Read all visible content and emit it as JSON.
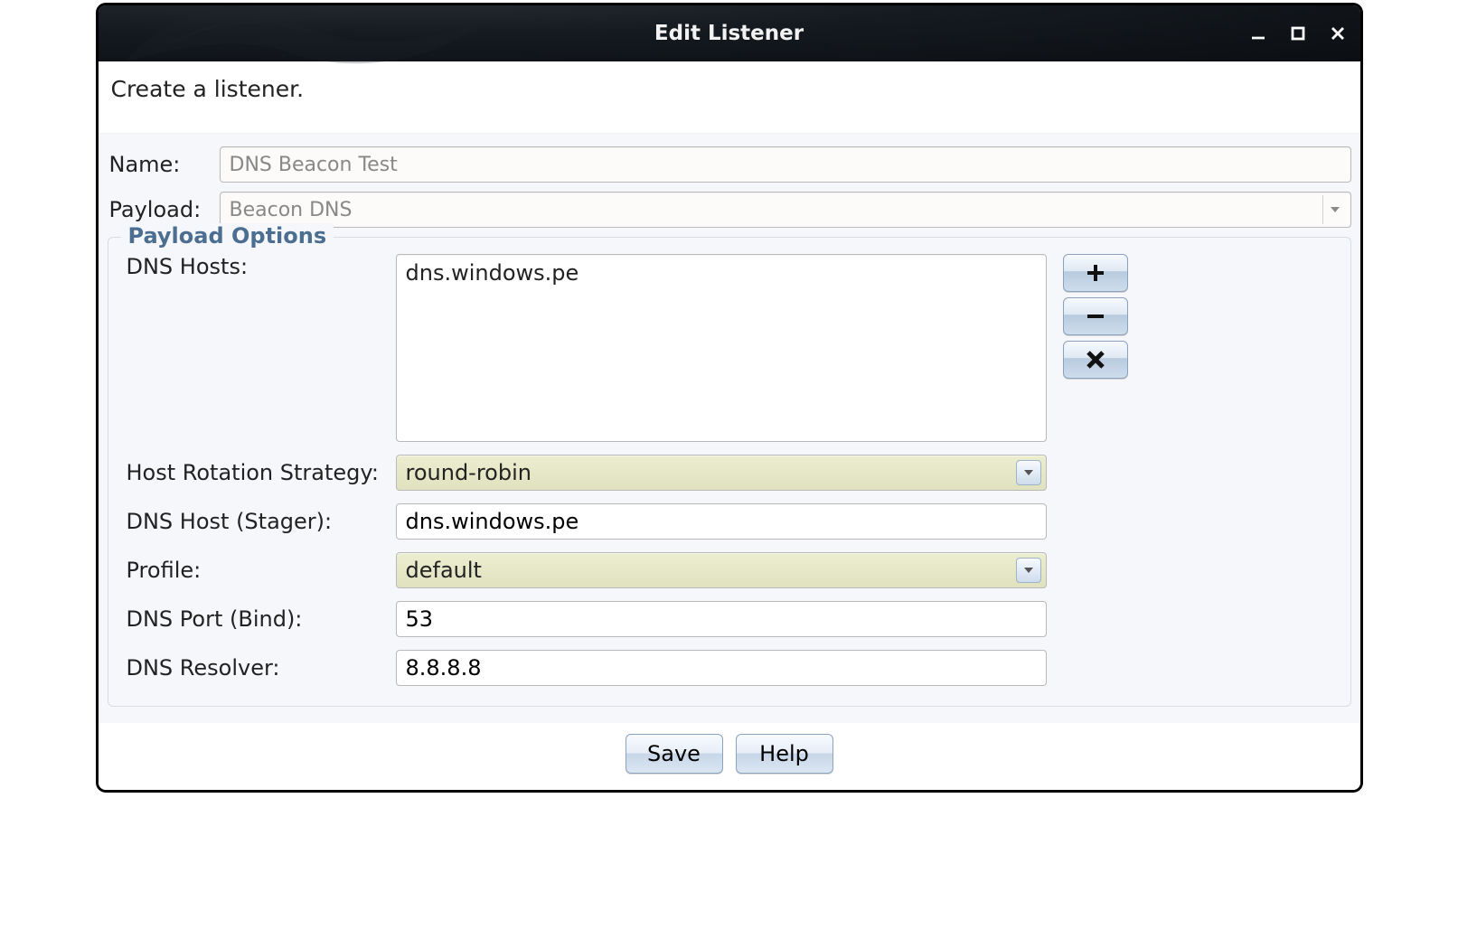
{
  "window": {
    "title": "Edit Listener"
  },
  "instruction": "Create a listener.",
  "form": {
    "name_label": "Name:",
    "name_value": "DNS Beacon Test",
    "payload_label": "Payload:",
    "payload_value": "Beacon DNS"
  },
  "options": {
    "legend": "Payload Options",
    "dns_hosts_label": "DNS Hosts:",
    "dns_hosts_value": "dns.windows.pe",
    "rotation_label": "Host Rotation Strategy:",
    "rotation_value": "round-robin",
    "stager_label": "DNS Host (Stager):",
    "stager_value": "dns.windows.pe",
    "profile_label": "Profile:",
    "profile_value": "default",
    "port_label": "DNS Port (Bind):",
    "port_value": "53",
    "resolver_label": "DNS Resolver:",
    "resolver_value": "8.8.8.8"
  },
  "buttons": {
    "save": "Save",
    "help": "Help"
  }
}
